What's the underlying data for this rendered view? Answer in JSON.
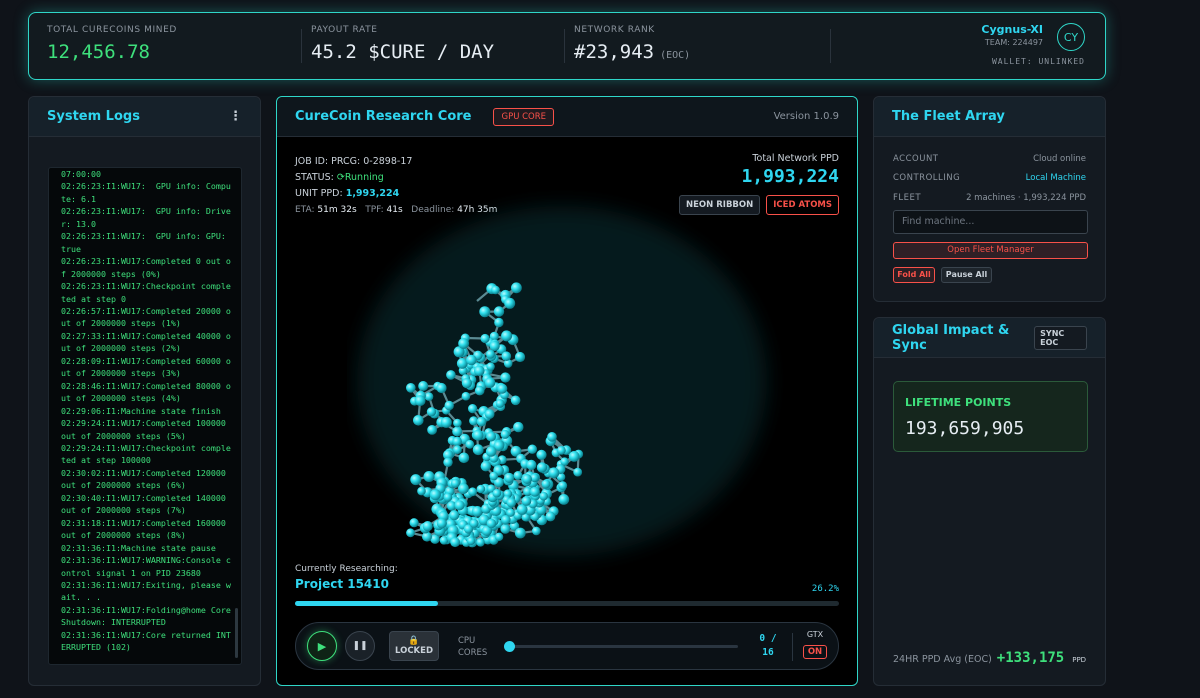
{
  "stats": {
    "mined_label": "TOTAL CURECOINS MINED",
    "mined_value": "12,456.78",
    "payout_label": "PAYOUT RATE",
    "payout_value": "45.2 $CURE / DAY",
    "rank_label": "NETWORK RANK",
    "rank_value": "#23,943",
    "rank_suffix": "(EOC)"
  },
  "user": {
    "name": "Cygnus-XI",
    "team": "TEAM: 224497",
    "initials": "CY",
    "wallet": "WALLET: UNLINKED"
  },
  "logs": {
    "title": "System Logs",
    "lines": "07:00:00\n02:26:23:I1:WU17:  GPU info: Compute: 6.1\n02:26:23:I1:WU17:  GPU info: Driver: 13.0\n02:26:23:I1:WU17:  GPU info: GPU: true\n02:26:23:I1:WU17:Completed 0 out of 2000000 steps (0%)\n02:26:23:I1:WU17:Checkpoint completed at step 0\n02:26:57:I1:WU17:Completed 20000 out of 2000000 steps (1%)\n02:27:33:I1:WU17:Completed 40000 out of 2000000 steps (2%)\n02:28:09:I1:WU17:Completed 60000 out of 2000000 steps (3%)\n02:28:46:I1:WU17:Completed 80000 out of 2000000 steps (4%)\n02:29:06:I1:Machine state finish\n02:29:24:I1:WU17:Completed 100000 out of 2000000 steps (5%)\n02:29:24:I1:WU17:Checkpoint completed at step 100000\n02:30:02:I1:WU17:Completed 120000 out of 2000000 steps (6%)\n02:30:40:I1:WU17:Completed 140000 out of 2000000 steps (7%)\n02:31:18:I1:WU17:Completed 160000 out of 2000000 steps (8%)\n02:31:36:I1:Machine state pause\n02:31:36:I1:WU17:WARNING:Console control signal 1 on PID 23680\n02:31:36:I1:WU17:Exiting, please wait. . .\n02:31:36:I1:WU17:Folding@home Core Shutdown: INTERRUPTED\n02:31:36:I1:WU17:Core returned INTERRUPTED (102)"
  },
  "core": {
    "title": "CureCoin Research Core",
    "tag": "GPU CORE",
    "version": "Version 1.0.9",
    "job_label": "JOB ID:",
    "job_id": "PRCG: 0-2898-17",
    "status_label": "STATUS:",
    "status_icon": "refresh-icon",
    "status": "Running",
    "unit_ppd_label": "UNIT PPD:",
    "unit_ppd": "1,993,224",
    "eta_label": "ETA:",
    "eta": "51m 32s",
    "tpf_label": "TPF:",
    "tpf": "41s",
    "deadline_label": "Deadline:",
    "deadline": "47h 35m",
    "net_ppd_label": "Total Network PPD",
    "net_ppd": "1,993,224",
    "viz_tag_1": "NEON RIBBON",
    "viz_tag_2": "ICED ATOMS",
    "researching_label": "Currently Researching:",
    "project": "Project 15410",
    "progress_text": "26.2%",
    "progress": 0.262,
    "lock_label": "LOCKED",
    "cpu_label": "CPU CORES",
    "cores_used": "0 /",
    "cores_total": "16",
    "cores_value": 0,
    "gtx_label": "GTX",
    "gtx_state": "ON"
  },
  "fleet": {
    "title": "The Fleet Array",
    "account_label": "ACCOUNT",
    "account_value": "Cloud online",
    "controlling_label": "CONTROLLING",
    "controlling_value": "Local Machine",
    "fleet_label": "FLEET",
    "fleet_value": "2 machines · 1,993,224 PPD",
    "search_placeholder": "Find machine...",
    "open_btn": "Open Fleet Manager",
    "fold_all": "Fold All",
    "pause_all": "Pause All"
  },
  "impact": {
    "title": "Global Impact & Sync",
    "sync_btn": "SYNC EOC",
    "lifetime_label": "LIFETIME POINTS",
    "lifetime_value": "193,659,905",
    "ppd_avg_label": "24HR PPD Avg (EOC)",
    "ppd_avg_value": "+133,175",
    "ppd_unit": "PPD"
  },
  "colors": {
    "accent": "#2fd6f0",
    "green": "#3ee07c",
    "red": "#f85149",
    "background": "#0f1319"
  }
}
